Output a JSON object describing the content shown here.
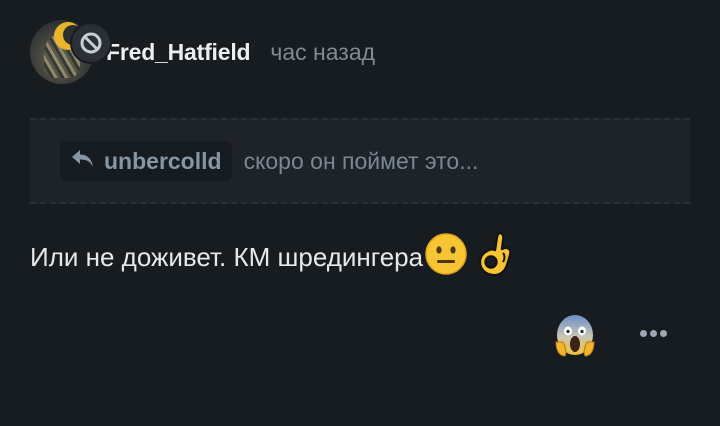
{
  "comment": {
    "author": "Fred_Hatfield",
    "time_ago": "час назад",
    "quote": {
      "reply_to": "unbercolld",
      "text": "скоро он поймет это..."
    },
    "body": "Или не доживет. КМ шредингера",
    "body_emojis": [
      "neutral-face",
      "ok-hand"
    ],
    "reaction_emoji": "face-screaming-in-fear",
    "more_icon": "ellipsis"
  },
  "colors": {
    "background": "#171c21",
    "quote_background": "#1d2328",
    "muted_text": "#7f8a94",
    "avatar_moon": "#e9b52b"
  }
}
